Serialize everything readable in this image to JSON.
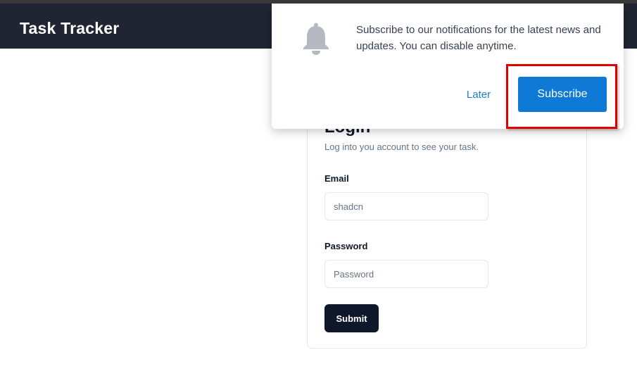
{
  "header": {
    "app_title": "Task Tracker"
  },
  "login": {
    "title": "Login",
    "subtitle": "Log into you account to see your task.",
    "email_label": "Email",
    "email_value": "shadcn",
    "password_label": "Password",
    "password_placeholder": "Password",
    "submit_label": "Submit"
  },
  "notification": {
    "icon": "bell-icon",
    "message": "Subscribe to our notifications for the latest news and updates. You can disable anytime.",
    "later_label": "Later",
    "subscribe_label": "Subscribe"
  },
  "colors": {
    "header_bg": "#1f2532",
    "subscribe_bg": "#0f79d6",
    "later_text": "#1a7fc9",
    "submit_bg": "#0f172a",
    "highlight": "#e00000"
  }
}
